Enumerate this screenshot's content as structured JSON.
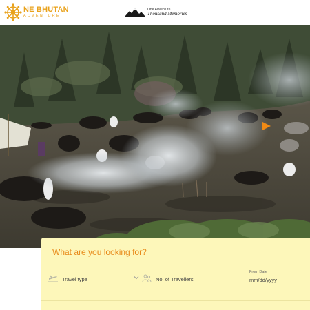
{
  "header": {
    "logo": {
      "main": "NE BHUTAN",
      "sub": "ADVENTURE"
    },
    "partner": {
      "top": "One Adventure",
      "bottom": "Thousand Memories"
    }
  },
  "hero": {
    "icon": "play-arrow-icon"
  },
  "search": {
    "title": "What are you looking for?",
    "travel_type": {
      "placeholder": "Travel type",
      "icon": "plane-icon"
    },
    "travellers": {
      "placeholder": "No. of Travellers",
      "icon": "people-icon"
    },
    "from_date": {
      "label": "From Date",
      "placeholder": "mm/dd/yyyy"
    }
  },
  "colors": {
    "accent": "#e9a21c",
    "panel": "#fdf7ba",
    "play": "#f08a15"
  }
}
